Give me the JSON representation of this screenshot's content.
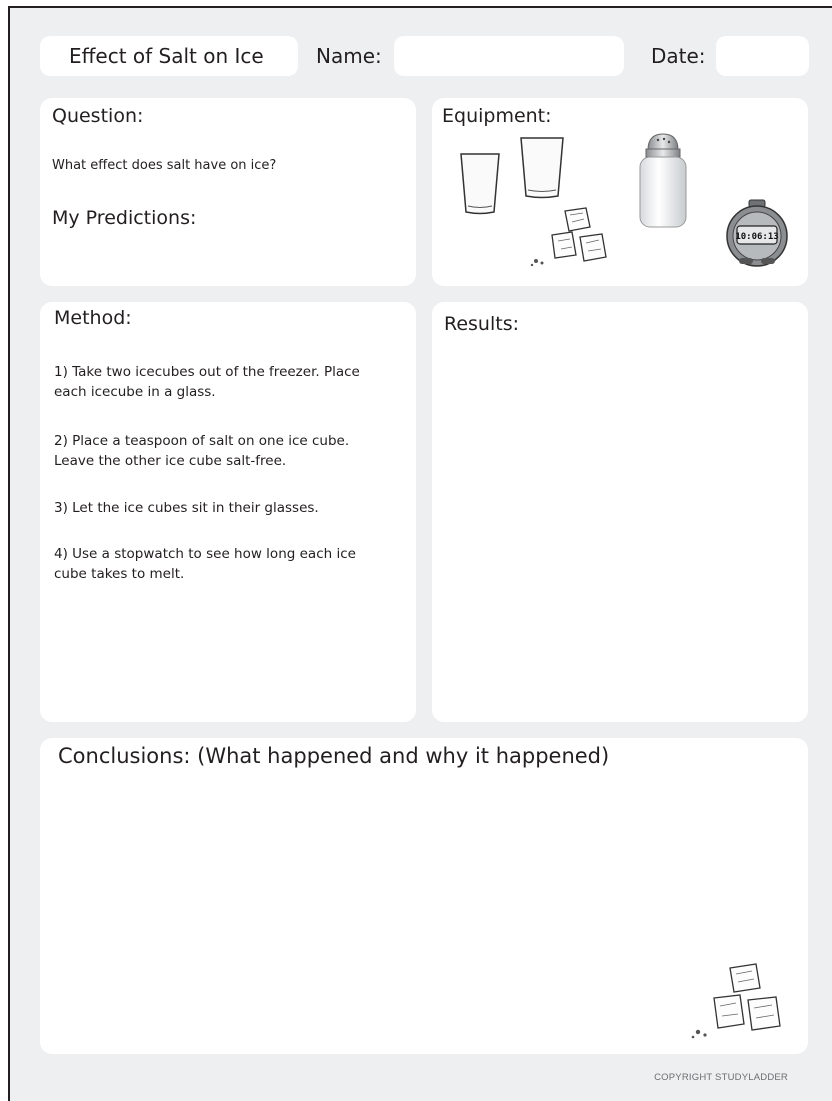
{
  "header": {
    "title": "Effect of Salt on Ice",
    "name_label": "Name:",
    "date_label": "Date:"
  },
  "question": {
    "heading": "Question:",
    "text": "What effect does salt have on ice?",
    "predictions_heading": "My Predictions:"
  },
  "equipment": {
    "heading": "Equipment:",
    "stopwatch_display": "10:06:13",
    "icons": [
      "glass-icon",
      "glass-icon",
      "ice-cubes-icon",
      "salt-shaker-icon",
      "stopwatch-icon"
    ]
  },
  "method": {
    "heading": "Method:",
    "steps": [
      {
        "line1": "1) Take two icecubes out of the freezer. Place",
        "line2": "each icecube in a glass."
      },
      {
        "line1": "2) Place a teaspoon of salt on one ice cube.",
        "line2": "Leave the other ice cube salt-free."
      },
      {
        "line1": "3) Let the ice cubes sit in their glasses.",
        "line2": ""
      },
      {
        "line1": "4) Use a stopwatch to see how long each ice",
        "line2": "cube takes to melt."
      }
    ]
  },
  "results": {
    "heading": "Results:"
  },
  "conclusions": {
    "heading": "Conclusions: (What happened and why it happened)"
  },
  "footer": {
    "copyright": "COPYRIGHT STUDYLADDER"
  }
}
